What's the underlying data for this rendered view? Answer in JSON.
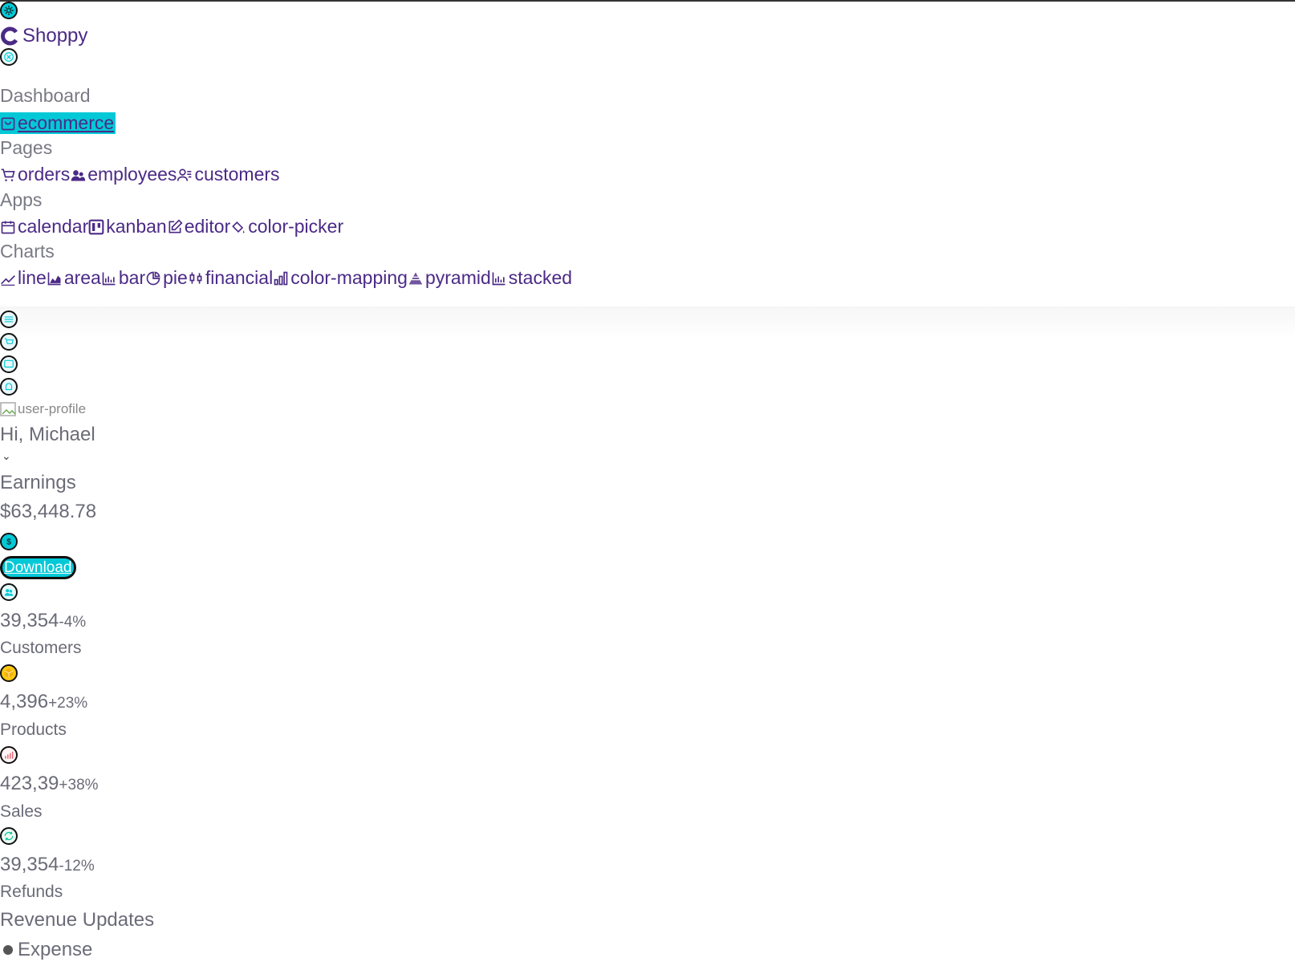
{
  "app": {
    "brand": "Shoppy"
  },
  "sidebar": {
    "sections": [
      {
        "title": "Dashboard",
        "items": [
          {
            "label": "ecommerce",
            "icon": "shopping-bag-icon",
            "active": true
          }
        ]
      },
      {
        "title": "Pages",
        "items": [
          {
            "label": "orders",
            "icon": "cart-icon"
          },
          {
            "label": "employees",
            "icon": "people-icon"
          },
          {
            "label": "customers",
            "icon": "user-list-icon"
          }
        ]
      },
      {
        "title": "Apps",
        "items": [
          {
            "label": "calendar",
            "icon": "calendar-icon"
          },
          {
            "label": "kanban",
            "icon": "kanban-icon"
          },
          {
            "label": "editor",
            "icon": "edit-icon"
          },
          {
            "label": "color-picker",
            "icon": "paint-bucket-icon"
          }
        ]
      },
      {
        "title": "Charts",
        "items": [
          {
            "label": "line",
            "icon": "line-chart-icon"
          },
          {
            "label": "area",
            "icon": "area-chart-icon"
          },
          {
            "label": "bar",
            "icon": "bar-chart-icon"
          },
          {
            "label": "pie",
            "icon": "pie-chart-icon"
          },
          {
            "label": "financial",
            "icon": "candlestick-icon"
          },
          {
            "label": "color-mapping",
            "icon": "color-mapping-icon"
          },
          {
            "label": "pyramid",
            "icon": "pyramid-icon"
          },
          {
            "label": "stacked",
            "icon": "stacked-chart-icon"
          }
        ]
      }
    ]
  },
  "navbar": {
    "profile_alt": "user-profile",
    "greeting": "Hi, Michael"
  },
  "earnings": {
    "label": "Earnings",
    "value": "$63,448.78",
    "download_label": "Download"
  },
  "stats": [
    {
      "value": "39,354",
      "pct": "-4%",
      "label": "Customers",
      "icon": "customers-icon",
      "color": "#03c9d7"
    },
    {
      "value": "4,396",
      "pct": "+23%",
      "label": "Products",
      "icon": "box-icon",
      "color": "#fec90f"
    },
    {
      "value": "423,39",
      "pct": "+38%",
      "label": "Sales",
      "icon": "sales-chart-icon",
      "color": "#e46a76"
    },
    {
      "value": "39,354",
      "pct": "-12%",
      "label": "Refunds",
      "icon": "refund-icon",
      "color": "#00c292"
    }
  ],
  "revenue": {
    "title": "Revenue Updates",
    "legend": "Expense"
  },
  "colors": {
    "accent": "#03c9d7",
    "brand_purple": "#4b2a86"
  }
}
